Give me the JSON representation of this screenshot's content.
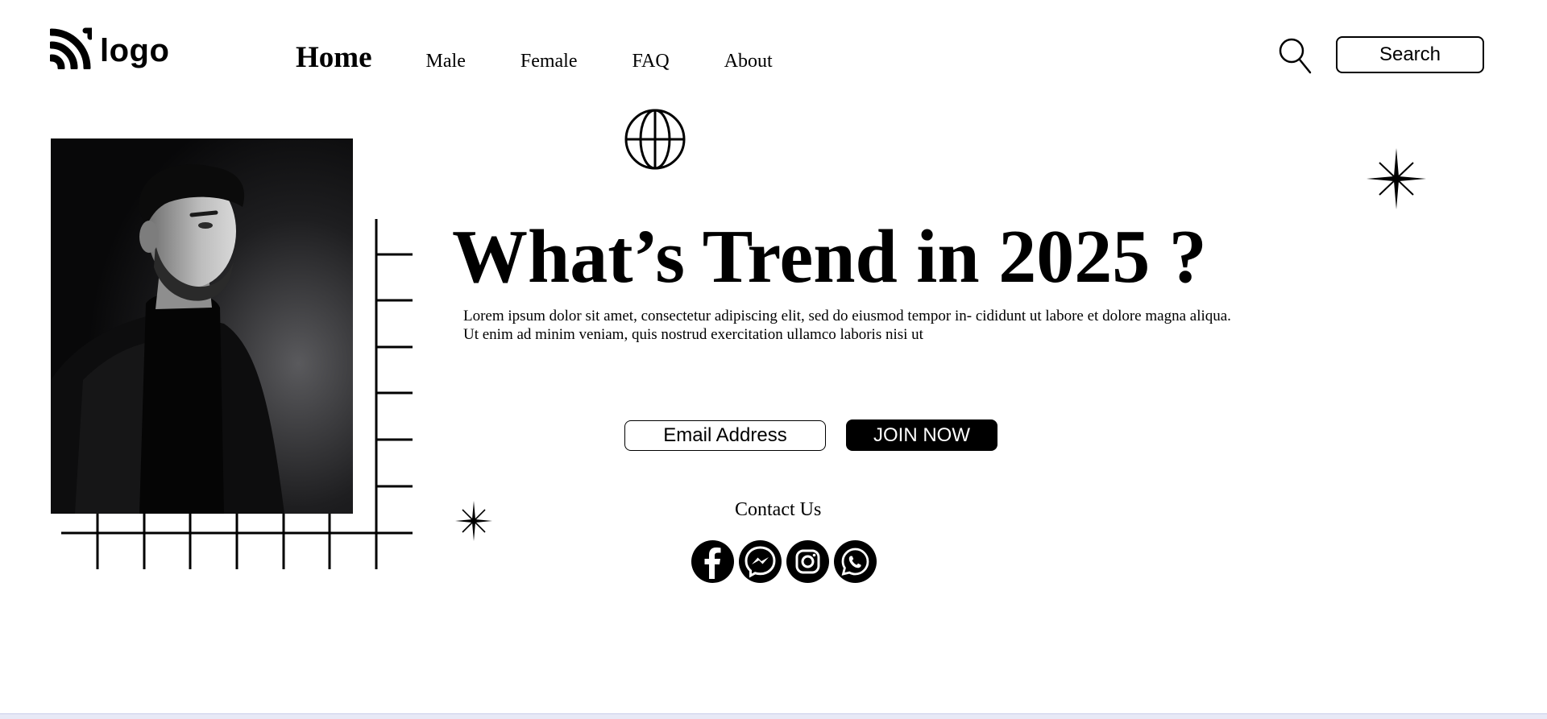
{
  "header": {
    "logo_text": "logo",
    "logo_icon": "wifi-arc-logo-icon",
    "nav": [
      {
        "label": "Home",
        "active": true
      },
      {
        "label": "Male",
        "active": false
      },
      {
        "label": "Female",
        "active": false
      },
      {
        "label": "FAQ",
        "active": false
      },
      {
        "label": "About",
        "active": false
      }
    ],
    "search_icon": "magnifier-icon",
    "search_label": "Search"
  },
  "hero": {
    "headline": "What’s Trend in 2025 ?",
    "body": "Lorem ipsum dolor sit amet, consectetur adipiscing elit, sed do eiusmod tempor in- cididunt ut labore et dolore magna aliqua. Ut enim ad minim veniam, quis nostrud exercitation ullamco laboris nisi ut"
  },
  "join": {
    "email_placeholder": "Email Address",
    "button_label": "JOIN NOW"
  },
  "contact": {
    "title": "Contact Us",
    "icons": [
      "facebook-icon",
      "messenger-icon",
      "instagram-icon",
      "whatsapp-icon"
    ]
  },
  "decor": {
    "icons": [
      "globe-icon",
      "sparkle-star-icon",
      "grid-lines"
    ],
    "photo": "portrait-photo"
  },
  "colors": {
    "primary": "#000000",
    "background": "#ffffff"
  }
}
